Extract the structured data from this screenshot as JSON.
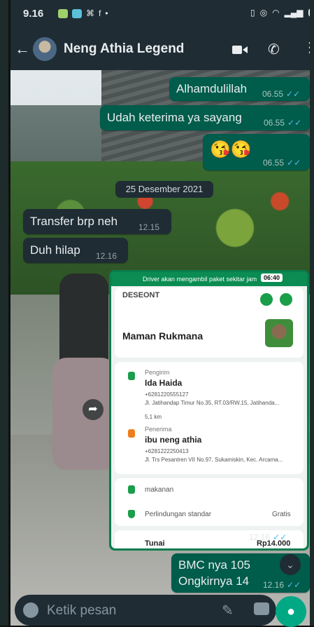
{
  "status_bar": {
    "time": "9.16"
  },
  "header": {
    "contact_name": "Neng Athia Legend"
  },
  "messages": [
    {
      "text": "Alhamdulillah",
      "time": "06.55"
    },
    {
      "text": "Udah keterima ya sayang",
      "time": "06.55"
    },
    {
      "text": "😘😘",
      "time": "06.55"
    },
    {
      "text": "Transfer brp neh",
      "time": "12.15"
    },
    {
      "text": "Duh hilap",
      "time": "12.16"
    },
    {
      "text": "BMC nya 105",
      "text2": "Ongkirnya 14",
      "time": "12.16"
    }
  ],
  "date_chip": "25 Desember 2021",
  "image": {
    "driver_bar": "Driver akan mengambil paket sekitar jam",
    "driver_time": "06:40",
    "top_label": "DESEONT",
    "courier_name": "Maman Rukmana",
    "sender_label": "Pengirim",
    "sender_name": "Ida Haida",
    "sender_phone": "+6281220555127",
    "sender_address": "Jl. Jatihandap Timur No.35, RT.03/RW.15, Jatihanda...",
    "distance": "5,1 km",
    "recipient_label": "Penerima",
    "recipient_name": "ibu neng athia",
    "recipient_phone": "+6281222250413",
    "recipient_address": "Jl. Trs Pesantren VII No.97, Sukamiskin, Kec. Arcama...",
    "item": "makanan",
    "protection": "Perlindungan standar",
    "protection_price": "Gratis",
    "payment": "Tunai",
    "total": "Rp14.000",
    "time": "12.16"
  },
  "input": {
    "placeholder": "Ketik pesan"
  }
}
